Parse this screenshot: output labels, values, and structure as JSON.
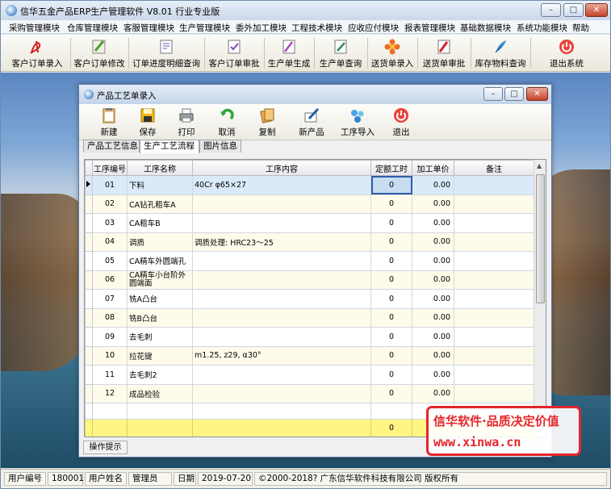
{
  "app": {
    "title": "信华五金产品ERP生产管理软件  V8.01 行业专业版"
  },
  "menu": [
    "采购管理模块",
    "仓库管理模块",
    "客服管理模块",
    "生产管理模块",
    "委外加工模块",
    "工程技术模块",
    "应收应付模块",
    "报表管理模块",
    "基础数据模块",
    "系统功能模块",
    "帮助"
  ],
  "toolbar": [
    "客户订单录入",
    "客户订单修改",
    "订单进度明细查询",
    "客户订单审批",
    "生产单生成",
    "生产单查询",
    "送货单录入",
    "送货单审批",
    "库存物料查询",
    "退出系统"
  ],
  "child": {
    "title": "产品工艺单录入",
    "toolbar": [
      "新建",
      "保存",
      "打印",
      "取消",
      "复制",
      "新产品",
      "工序导入",
      "退出"
    ],
    "tabs": [
      "产品工艺信息",
      "生产工艺流程",
      "图片信息"
    ],
    "active_tab": "生产工艺流程",
    "columns": [
      "工序编号",
      "工序名称",
      "工序内容",
      "定额工时",
      "加工单价",
      "备注"
    ],
    "rows": [
      {
        "no": "01",
        "name": "下料",
        "content": "40Cr   φ65×27",
        "hours": "0",
        "price": "0.00",
        "note": ""
      },
      {
        "no": "02",
        "name": "CA钻孔粗车A",
        "content": "",
        "hours": "0",
        "price": "0.00",
        "note": ""
      },
      {
        "no": "03",
        "name": "CA粗车B",
        "content": "",
        "hours": "0",
        "price": "0.00",
        "note": ""
      },
      {
        "no": "04",
        "name": "调质",
        "content": "调质处理: HRC23～25",
        "hours": "0",
        "price": "0.00",
        "note": ""
      },
      {
        "no": "05",
        "name": "CA精车外圆端孔",
        "content": "",
        "hours": "0",
        "price": "0.00",
        "note": ""
      },
      {
        "no": "06",
        "name": "CA精车小台阶外圆端面",
        "content": "",
        "hours": "0",
        "price": "0.00",
        "note": ""
      },
      {
        "no": "07",
        "name": "铣A凸台",
        "content": "",
        "hours": "0",
        "price": "0.00",
        "note": ""
      },
      {
        "no": "08",
        "name": "铣B凸台",
        "content": "",
        "hours": "0",
        "price": "0.00",
        "note": ""
      },
      {
        "no": "09",
        "name": "去毛刺",
        "content": "",
        "hours": "0",
        "price": "0.00",
        "note": ""
      },
      {
        "no": "10",
        "name": "拉花键",
        "content": "m1.25, z29, α30°",
        "hours": "0",
        "price": "0.00",
        "note": ""
      },
      {
        "no": "11",
        "name": "去毛刺2",
        "content": "",
        "hours": "0",
        "price": "0.00",
        "note": ""
      },
      {
        "no": "12",
        "name": "成品检验",
        "content": "",
        "hours": "0",
        "price": "0.00",
        "note": ""
      }
    ],
    "total_hours": "0",
    "hint": "操作提示"
  },
  "watermark": {
    "line1": "信华软件·品质决定价值",
    "line2": "www.xinwa.cn"
  },
  "status": {
    "user_id_label": "用户编号",
    "user_id": "180001",
    "user_name_label": "用户姓名",
    "user_name": "管理员",
    "date_label": "日期",
    "date": "2019-07-20",
    "copyright": "©2000-2018?  广东信华软件科技有限公司  版权所有"
  },
  "colors": {
    "accent": "#2c5fa8",
    "total_row": "#fef584",
    "odd_row": "#fffbea",
    "watermark": "#e3262c"
  }
}
